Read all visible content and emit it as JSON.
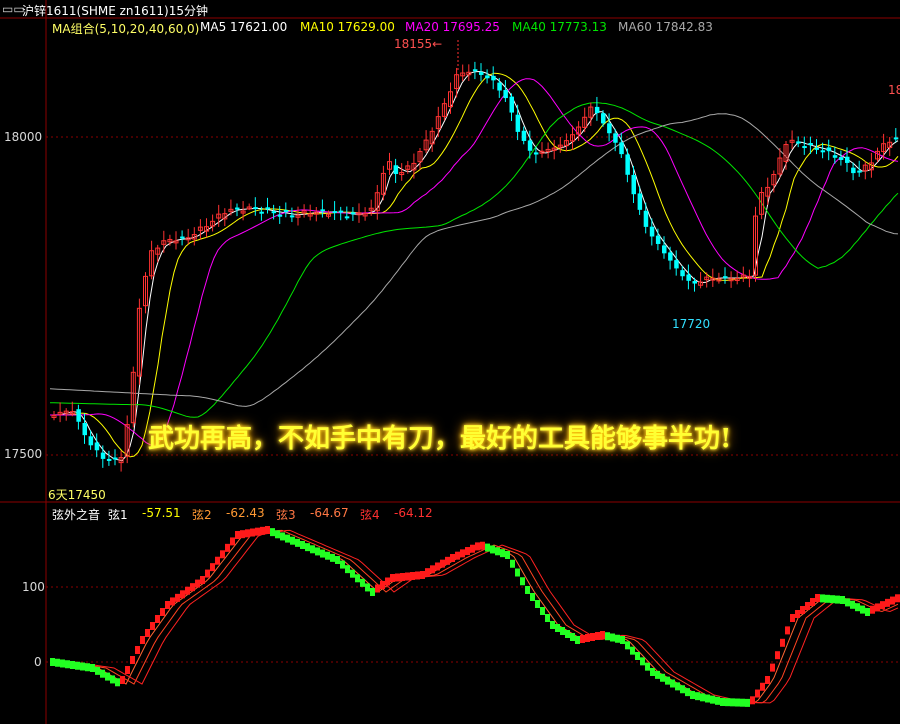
{
  "title_bar": {
    "icon": "link-icon",
    "symbol_text": "沪锌1611(SHME zn1611)15分钟"
  },
  "ma_legend": {
    "group_label": "MA组合(5,10,20,40,60,0)",
    "items": [
      {
        "label": "MA5 17621.00",
        "color": "#ffffff"
      },
      {
        "label": "MA10 17629.00",
        "color": "#ffff00"
      },
      {
        "label": "MA20 17695.25",
        "color": "#ff00ff"
      },
      {
        "label": "MA40 17773.13",
        "color": "#00e600"
      },
      {
        "label": "MA60 17842.83",
        "color": "#a8a8a8"
      }
    ]
  },
  "price_axis": {
    "labels": [
      "18000",
      "17500"
    ]
  },
  "annotations": {
    "high": "18155←",
    "low": "17720",
    "range_low": "6天17450",
    "right_edge": "18"
  },
  "overlay_text": "武功再高，不如手中有刀，最好的工具能够事半功!",
  "indicator": {
    "name": "弦外之音",
    "lines": [
      {
        "label": "弦1",
        "value": "-57.51",
        "color": "#ffff00"
      },
      {
        "label": "弦2",
        "value": "-62.43",
        "color": "#ff9933"
      },
      {
        "label": "弦3",
        "value": "-64.67",
        "color": "#ff7744"
      },
      {
        "label": "弦4",
        "value": "-64.12",
        "color": "#ff3030"
      }
    ],
    "axis_labels": [
      "100",
      "0"
    ]
  },
  "colors": {
    "up_candle": "#ff3232",
    "down_candle": "#00ffff",
    "grid": "#8b0000",
    "background": "#000000"
  }
}
